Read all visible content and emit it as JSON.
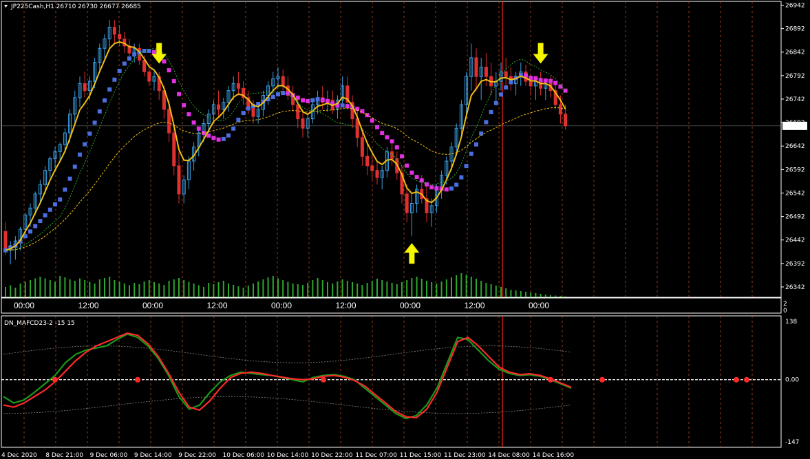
{
  "window": {
    "symbol_info": "JP225Cash,H1  26710 26730 26677 26685",
    "indicator_name": "DN_MAFCD23-2 -15 15"
  },
  "colors": {
    "background": "#000000",
    "frame": "#ffffff",
    "grid_vertical": "#c0501a",
    "bull_candle": "#3aa0e6",
    "bear_candle": "#e03030",
    "volume": "#2ea82e",
    "ma_blue": "#4a6ee0",
    "ma_magenta": "#e030e0",
    "yellow_line": "#f0c010",
    "arrow": "#f5f500",
    "current_time_line": "#ff2020",
    "osc_green": "#1a9a1a",
    "osc_red": "#ff2a2a",
    "zero_line": "#ffffff"
  },
  "chart_data": [
    {
      "type": "candlestick",
      "title": "JP225Cash,H1  26710 26730 26677 26685",
      "ylim": [
        26320,
        26950
      ],
      "y_ticks": [
        "26942",
        "26892",
        "26842",
        "26792",
        "26742",
        "26692",
        "26642",
        "26592",
        "26542",
        "26492",
        "26442",
        "26392",
        "26342"
      ],
      "current_price": "26685",
      "x_time_labels": [
        "00:00",
        "12:00",
        "00:00",
        "12:00",
        "00:00",
        "12:00",
        "00:00",
        "12:00",
        "00:00"
      ],
      "volume_axis_labels": [
        "2",
        "0"
      ],
      "arrows": [
        {
          "direction": "down",
          "bar": 31
        },
        {
          "direction": "up",
          "bar": 82
        },
        {
          "direction": "down",
          "bar": 108
        }
      ],
      "ohlc": [
        [
          26460,
          26480,
          26410,
          26420
        ],
        [
          26420,
          26440,
          26390,
          26430
        ],
        [
          26430,
          26450,
          26400,
          26440
        ],
        [
          26440,
          26470,
          26420,
          26465
        ],
        [
          26465,
          26500,
          26450,
          26495
        ],
        [
          26495,
          26520,
          26470,
          26510
        ],
        [
          26510,
          26545,
          26495,
          26540
        ],
        [
          26540,
          26570,
          26520,
          26560
        ],
        [
          26560,
          26600,
          26540,
          26590
        ],
        [
          26590,
          26620,
          26575,
          26615
        ],
        [
          26615,
          26640,
          26595,
          26630
        ],
        [
          26630,
          26650,
          26610,
          26645
        ],
        [
          26645,
          26680,
          26630,
          26670
        ],
        [
          26670,
          26720,
          26650,
          26710
        ],
        [
          26710,
          26760,
          26690,
          26745
        ],
        [
          26745,
          26790,
          26725,
          26775
        ],
        [
          26775,
          26800,
          26745,
          26760
        ],
        [
          26760,
          26790,
          26740,
          26780
        ],
        [
          26780,
          26830,
          26765,
          26820
        ],
        [
          26820,
          26860,
          26800,
          26850
        ],
        [
          26850,
          26880,
          26830,
          26870
        ],
        [
          26870,
          26910,
          26850,
          26895
        ],
        [
          26895,
          26910,
          26860,
          26880
        ],
        [
          26880,
          26900,
          26855,
          26870
        ],
        [
          26870,
          26885,
          26840,
          26855
        ],
        [
          26855,
          26870,
          26825,
          26840
        ],
        [
          26840,
          26860,
          26820,
          26850
        ],
        [
          26850,
          26860,
          26815,
          26825
        ],
        [
          26825,
          26835,
          26790,
          26800
        ],
        [
          26800,
          26815,
          26770,
          26780
        ],
        [
          26780,
          26800,
          26760,
          26790
        ],
        [
          26790,
          26800,
          26740,
          26760
        ],
        [
          26760,
          26770,
          26700,
          26720
        ],
        [
          26720,
          26740,
          26650,
          26670
        ],
        [
          26670,
          26690,
          26580,
          26600
        ],
        [
          26600,
          26630,
          26520,
          26540
        ],
        [
          26540,
          26580,
          26520,
          26570
        ],
        [
          26570,
          26620,
          26550,
          26610
        ],
        [
          26610,
          26650,
          26590,
          26640
        ],
        [
          26640,
          26680,
          26620,
          26670
        ],
        [
          26670,
          26700,
          26650,
          26690
        ],
        [
          26690,
          26720,
          26670,
          26710
        ],
        [
          26710,
          26740,
          26690,
          26730
        ],
        [
          26730,
          26760,
          26705,
          26720
        ],
        [
          26720,
          26745,
          26700,
          26735
        ],
        [
          26735,
          26770,
          26715,
          26760
        ],
        [
          26760,
          26790,
          26740,
          26775
        ],
        [
          26775,
          26800,
          26750,
          26765
        ],
        [
          26765,
          26780,
          26730,
          26745
        ],
        [
          26745,
          26760,
          26710,
          26725
        ],
        [
          26725,
          26740,
          26690,
          26705
        ],
        [
          26705,
          26730,
          26690,
          26720
        ],
        [
          26720,
          26760,
          26705,
          26750
        ],
        [
          26750,
          26780,
          26730,
          26770
        ],
        [
          26770,
          26800,
          26750,
          26785
        ],
        [
          26785,
          26810,
          26765,
          26790
        ],
        [
          26790,
          26805,
          26760,
          26770
        ],
        [
          26770,
          26790,
          26740,
          26750
        ],
        [
          26750,
          26770,
          26715,
          26730
        ],
        [
          26730,
          26750,
          26680,
          26700
        ],
        [
          26700,
          26720,
          26660,
          26680
        ],
        [
          26680,
          26710,
          26660,
          26700
        ],
        [
          26700,
          26740,
          26690,
          26730
        ],
        [
          26730,
          26760,
          26710,
          26745
        ],
        [
          26745,
          26770,
          26720,
          26735
        ],
        [
          26735,
          26760,
          26715,
          26740
        ],
        [
          26740,
          26760,
          26710,
          26720
        ],
        [
          26720,
          26750,
          26700,
          26740
        ],
        [
          26740,
          26790,
          26725,
          26770
        ],
        [
          26770,
          26790,
          26720,
          26735
        ],
        [
          26735,
          26750,
          26680,
          26700
        ],
        [
          26700,
          26720,
          26640,
          26660
        ],
        [
          26660,
          26680,
          26600,
          26620
        ],
        [
          26620,
          26650,
          26580,
          26600
        ],
        [
          26600,
          26630,
          26570,
          26590
        ],
        [
          26590,
          26610,
          26560,
          26575
        ],
        [
          26575,
          26600,
          26550,
          26590
        ],
        [
          26590,
          26640,
          26575,
          26630
        ],
        [
          26630,
          26650,
          26600,
          26615
        ],
        [
          26615,
          26630,
          26570,
          26585
        ],
        [
          26585,
          26600,
          26520,
          26540
        ],
        [
          26540,
          26560,
          26480,
          26500
        ],
        [
          26500,
          26540,
          26450,
          26520
        ],
        [
          26520,
          26560,
          26500,
          26550
        ],
        [
          26550,
          26580,
          26520,
          26530
        ],
        [
          26530,
          26560,
          26480,
          26500
        ],
        [
          26500,
          26530,
          26470,
          26515
        ],
        [
          26515,
          26560,
          26500,
          26550
        ],
        [
          26550,
          26590,
          26530,
          26580
        ],
        [
          26580,
          26620,
          26560,
          26610
        ],
        [
          26610,
          26650,
          26590,
          26640
        ],
        [
          26640,
          26690,
          26620,
          26680
        ],
        [
          26680,
          26740,
          26660,
          26730
        ],
        [
          26730,
          26800,
          26710,
          26790
        ],
        [
          26790,
          26860,
          26760,
          26830
        ],
        [
          26830,
          26850,
          26760,
          26790
        ],
        [
          26790,
          26830,
          26740,
          26810
        ],
        [
          26810,
          26840,
          26770,
          26790
        ],
        [
          26790,
          26820,
          26750,
          26770
        ],
        [
          26770,
          26800,
          26730,
          26780
        ],
        [
          26780,
          26820,
          26760,
          26800
        ],
        [
          26800,
          26830,
          26770,
          26790
        ],
        [
          26790,
          26810,
          26760,
          26775
        ],
        [
          26775,
          26800,
          26750,
          26790
        ],
        [
          26790,
          26820,
          26770,
          26800
        ],
        [
          26800,
          26815,
          26770,
          26780
        ],
        [
          26780,
          26795,
          26750,
          26770
        ],
        [
          26770,
          26790,
          26740,
          26780
        ],
        [
          26780,
          26800,
          26750,
          26765
        ],
        [
          26765,
          26785,
          26740,
          26775
        ],
        [
          26775,
          26790,
          26745,
          26760
        ],
        [
          26760,
          26775,
          26720,
          26730
        ],
        [
          26730,
          26750,
          26690,
          26710
        ],
        [
          26710,
          26730,
          26677,
          26685
        ]
      ],
      "volume": [
        0.3,
        0.35,
        0.28,
        0.4,
        0.45,
        0.5,
        0.55,
        0.6,
        0.55,
        0.5,
        0.45,
        0.62,
        0.58,
        0.52,
        0.48,
        0.55,
        0.5,
        0.45,
        0.4,
        0.52,
        0.56,
        0.6,
        0.5,
        0.45,
        0.4,
        0.35,
        0.42,
        0.38,
        0.46,
        0.5,
        0.44,
        0.4,
        0.36,
        0.48,
        0.52,
        0.56,
        0.5,
        0.45,
        0.4,
        0.35,
        0.3,
        0.42,
        0.38,
        0.44,
        0.48,
        0.4,
        0.36,
        0.32,
        0.28,
        0.34,
        0.4,
        0.46,
        0.52,
        0.58,
        0.62,
        0.55,
        0.5,
        0.45,
        0.4,
        0.38,
        0.36,
        0.42,
        0.5,
        0.56,
        0.5,
        0.44,
        0.4,
        0.46,
        0.52,
        0.48,
        0.44,
        0.4,
        0.36,
        0.42,
        0.48,
        0.54,
        0.5,
        0.46,
        0.42,
        0.38,
        0.44,
        0.5,
        0.56,
        0.6,
        0.54,
        0.48,
        0.44,
        0.4,
        0.46,
        0.52,
        0.58,
        0.64,
        0.7,
        0.66,
        0.6,
        0.54,
        0.48,
        0.42,
        0.38,
        0.34,
        0.3,
        0.26,
        0.22,
        0.2,
        0.18,
        0.16,
        0.14,
        0.12,
        0.1,
        0.08,
        0.06,
        0.05,
        0.04,
        0.03
      ]
    },
    {
      "type": "line",
      "title": "DN_MAFCD23-2 -15 15",
      "ylim": [
        -147,
        138
      ],
      "y_ticks": [
        "138",
        "0.00",
        "-147"
      ],
      "x_date_labels": [
        "4 Dec 2020",
        "8 Dec 21:00",
        "9 Dec 06:00",
        "9 Dec 14:00",
        "9 Dec 22:00",
        "10 Dec 06:00",
        "10 Dec 14:00",
        "10 Dec 22:00",
        "11 Dec 07:00",
        "11 Dec 15:00",
        "11 Dec 23:00",
        "14 Dec 08:00",
        "14 Dec 16:00"
      ],
      "series": [
        {
          "values": [
            -40,
            -55,
            -48,
            -30,
            -10,
            10,
            40,
            60,
            70,
            75,
            80,
            95,
            108,
            100,
            80,
            50,
            10,
            -40,
            -70,
            -60,
            -30,
            -5,
            10,
            18,
            15,
            12,
            10,
            5,
            0,
            -5,
            5,
            10,
            12,
            8,
            0,
            -20,
            -40,
            -60,
            -80,
            -92,
            -85,
            -60,
            -20,
            40,
            100,
            95,
            70,
            45,
            25,
            15,
            10,
            12,
            8,
            0,
            -10,
            -20
          ]
        },
        {
          "values": [
            -60,
            -65,
            -55,
            -40,
            -25,
            -5,
            20,
            45,
            65,
            80,
            90,
            100,
            110,
            105,
            85,
            55,
            15,
            -30,
            -65,
            -72,
            -50,
            -20,
            5,
            15,
            18,
            15,
            10,
            6,
            2,
            0,
            2,
            8,
            10,
            6,
            -2,
            -15,
            -35,
            -55,
            -75,
            -88,
            -90,
            -70,
            -30,
            30,
            90,
            100,
            80,
            55,
            30,
            18,
            12,
            14,
            10,
            2,
            -8,
            -18
          ]
        }
      ],
      "signal_dots": [
        5,
        13,
        31,
        53,
        58,
        71,
        72
      ]
    }
  ]
}
